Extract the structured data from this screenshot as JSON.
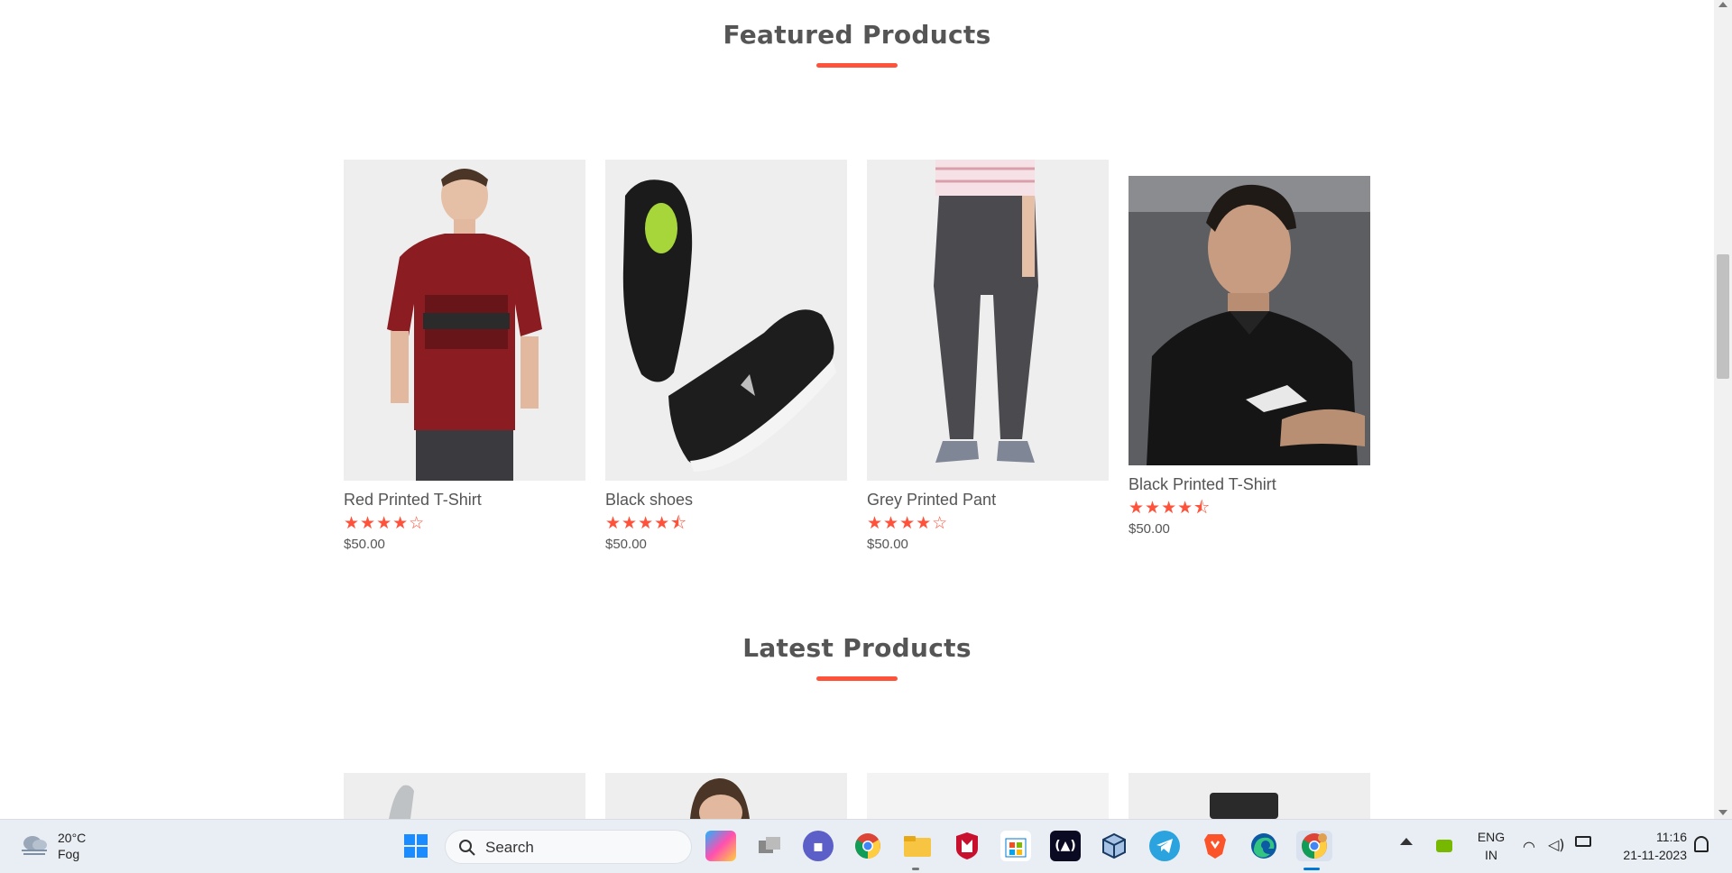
{
  "sections": {
    "featured_title": "Featured Products",
    "latest_title": "Latest Products"
  },
  "featured_products": [
    {
      "name": "Red Printed T-Shirt",
      "stars": "★★★★☆",
      "rating": 4.0,
      "price": "$50.00"
    },
    {
      "name": "Black shoes",
      "stars": "★★★★⯪",
      "rating": 4.5,
      "price": "$50.00"
    },
    {
      "name": "Grey Printed Pant",
      "stars": "★★★★☆",
      "rating": 4.0,
      "price": "$50.00"
    },
    {
      "name": "Black Printed T-Shirt",
      "stars": "★★★★⯪",
      "rating": 4.5,
      "price": "$50.00"
    }
  ],
  "colors": {
    "accent": "#ff523b",
    "text": "#555555",
    "card_bg": "#f3f3f3"
  },
  "taskbar": {
    "weather_temp": "20°C",
    "weather_desc": "Fog",
    "search_placeholder": "Search",
    "lang_top": "ENG",
    "lang_bottom": "IN",
    "time": "11:16",
    "date": "21-11-2023",
    "icons": [
      "windows-start-icon",
      "copilot-icon",
      "task-view-icon",
      "teams-icon",
      "chrome-icon",
      "file-explorer-icon",
      "mcafee-icon",
      "ms-store-icon",
      "code-icon",
      "virtualbox-icon",
      "telegram-icon",
      "brave-icon",
      "edge-icon",
      "chrome-profile-icon"
    ]
  }
}
